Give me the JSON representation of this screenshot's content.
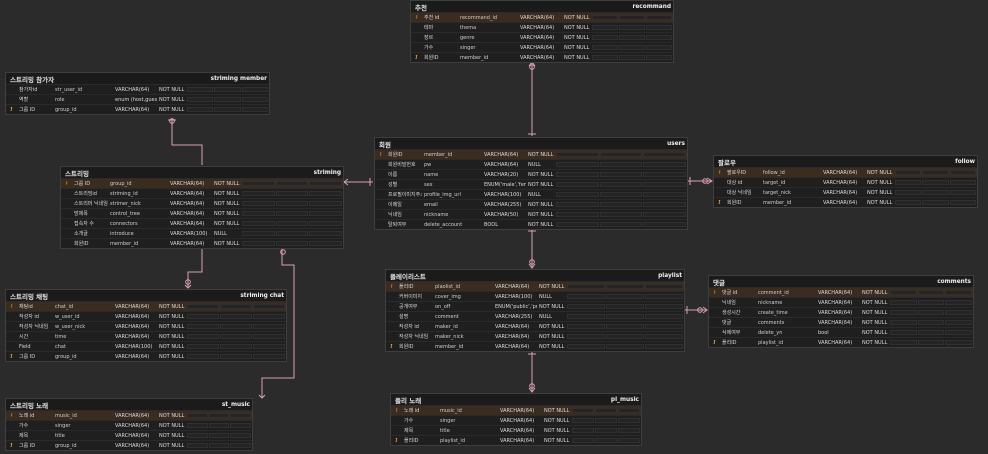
{
  "tables": [
    {
      "id": "recommand",
      "logical": "추천",
      "physical": "recommand",
      "rows": [
        {
          "key": "PK",
          "logical": "추천 id",
          "physical": "recommand_id",
          "type": "VARCHAR(64)",
          "nn": "NOT NULL"
        },
        {
          "key": "",
          "logical": "테마",
          "physical": "thema",
          "type": "VARCHAR(64)",
          "nn": "NOT NULL"
        },
        {
          "key": "",
          "logical": "장르",
          "physical": "genre",
          "type": "VARCHAR(64)",
          "nn": "NOT NULL"
        },
        {
          "key": "",
          "logical": "가수",
          "physical": "singer",
          "type": "VARCHAR(64)",
          "nn": "NOT NULL"
        },
        {
          "key": "FK",
          "logical": "회원ID",
          "physical": "member_id",
          "type": "VARCHAR(64)",
          "nn": "NOT NULL"
        }
      ]
    },
    {
      "id": "striming_member",
      "logical": "스트리밍 참가자",
      "physical": "striming member",
      "rows": [
        {
          "key": "",
          "logical": "참가자id",
          "physical": "str_user_id",
          "type": "VARCHAR(64)",
          "nn": "NOT NULL"
        },
        {
          "key": "",
          "logical": "역할",
          "physical": "role",
          "type": "enum (host,guest)",
          "nn": "NOT NULL"
        },
        {
          "key": "FK",
          "logical": "그룹 ID",
          "physical": "group_id",
          "type": "VARCHAR(64)",
          "nn": "NOT NULL"
        }
      ]
    },
    {
      "id": "users",
      "logical": "회원",
      "physical": "users",
      "rows": [
        {
          "key": "PK",
          "logical": "회원ID",
          "physical": "member_id",
          "type": "VARCHAR(64)",
          "nn": "NOT NULL"
        },
        {
          "key": "",
          "logical": "회원비밀번호",
          "physical": "pw",
          "type": "VARCHAR(64)",
          "nn": "NULL"
        },
        {
          "key": "",
          "logical": "이름",
          "physical": "name",
          "type": "VARCHAR(20)",
          "nn": "NOT NULL"
        },
        {
          "key": "",
          "logical": "성별",
          "physical": "sex",
          "type": "ENUM('male','female')",
          "nn": "NOT NULL"
        },
        {
          "key": "",
          "logical": "프로필이미지주소",
          "physical": "profile_img_url",
          "type": "VARCHAR(100)",
          "nn": "NULL"
        },
        {
          "key": "",
          "logical": "이메일",
          "physical": "email",
          "type": "VARCHAR(255)",
          "nn": "NOT NULL"
        },
        {
          "key": "",
          "logical": "닉네임",
          "physical": "nickname",
          "type": "VARCHAR(50)",
          "nn": "NOT NULL"
        },
        {
          "key": "",
          "logical": "탈퇴여부",
          "physical": "delete_account",
          "type": "BOOL",
          "nn": "NOT NULL"
        }
      ]
    },
    {
      "id": "striming",
      "logical": "스트리밍",
      "physical": "striming",
      "rows": [
        {
          "key": "PK",
          "logical": "그룹 ID",
          "physical": "group_id",
          "type": "VARCHAR(64)",
          "nn": "NOT NULL"
        },
        {
          "key": "",
          "logical": "스트리밍id",
          "physical": "striming_id",
          "type": "VARCHAR(64)",
          "nn": "NOT NULL"
        },
        {
          "key": "",
          "logical": "스트리머 닉네임",
          "physical": "strimer_nick",
          "type": "VARCHAR(64)",
          "nn": "NOT NULL"
        },
        {
          "key": "",
          "logical": "방제목",
          "physical": "control_tree",
          "type": "VARCHAR(64)",
          "nn": "NOT NULL"
        },
        {
          "key": "",
          "logical": "접속자 수",
          "physical": "connectors",
          "type": "VARCHAR(64)",
          "nn": "NOT NULL"
        },
        {
          "key": "",
          "logical": "소개글",
          "physical": "introduce",
          "type": "VARCHAR(100)",
          "nn": "NULL"
        },
        {
          "key": "",
          "logical": "회원ID",
          "physical": "member_id",
          "type": "VARCHAR(64)",
          "nn": "NOT NULL"
        }
      ]
    },
    {
      "id": "follow",
      "logical": "팔로우",
      "physical": "follow",
      "rows": [
        {
          "key": "PK",
          "logical": "팔로우ID",
          "physical": "follow_id",
          "type": "VARCHAR(64)",
          "nn": "NOT NULL"
        },
        {
          "key": "",
          "logical": "대상 id",
          "physical": "target_id",
          "type": "VARCHAR(64)",
          "nn": "NOT NULL"
        },
        {
          "key": "",
          "logical": "대상 닉네임",
          "physical": "target_nick",
          "type": "VARCHAR(64)",
          "nn": "NOT NULL"
        },
        {
          "key": "FK",
          "logical": "회원ID",
          "physical": "member_id",
          "type": "VARCHAR(64)",
          "nn": "NOT NULL"
        }
      ]
    },
    {
      "id": "playlist",
      "logical": "플레이리스트",
      "physical": "playlist",
      "rows": [
        {
          "key": "PK",
          "logical": "플리ID",
          "physical": "plaolist_id",
          "type": "VARCHAR(64)",
          "nn": "NOT NULL"
        },
        {
          "key": "",
          "logical": "커버이미지",
          "physical": "cover_img",
          "type": "VARCHAR(100)",
          "nn": "NULL"
        },
        {
          "key": "",
          "logical": "공개여부",
          "physical": "on_off",
          "type": "ENUM('public','private')",
          "nn": "NOT NULL"
        },
        {
          "key": "",
          "logical": "설명",
          "physical": "comment",
          "type": "VARCHAR(255)",
          "nn": "NULL"
        },
        {
          "key": "",
          "logical": "작성자 id",
          "physical": "maker_id",
          "type": "VARCHAR(64)",
          "nn": "NOT NULL"
        },
        {
          "key": "",
          "logical": "작성자 닉네임",
          "physical": "maker_nick",
          "type": "VARCHAR(64)",
          "nn": "NOT NULL"
        },
        {
          "key": "FK",
          "logical": "회원ID",
          "physical": "member_id",
          "type": "VARCHAR(64)",
          "nn": "NOT NULL"
        }
      ]
    },
    {
      "id": "comments",
      "logical": "댓글",
      "physical": "comments",
      "rows": [
        {
          "key": "PK",
          "logical": "댓글 id",
          "physical": "comment_id",
          "type": "VARCHAR(64)",
          "nn": "NOT NULL"
        },
        {
          "key": "",
          "logical": "닉네임",
          "physical": "nickname",
          "type": "VARCHAR(64)",
          "nn": "NOT NULL"
        },
        {
          "key": "",
          "logical": "생성시간",
          "physical": "create_time",
          "type": "VARCHAR(64)",
          "nn": "NOT NULL"
        },
        {
          "key": "",
          "logical": "댓글",
          "physical": "comments",
          "type": "VARCHAR(64)",
          "nn": "NOT NULL"
        },
        {
          "key": "",
          "logical": "삭제여부",
          "physical": "delete_yn",
          "type": "bool",
          "nn": "NOT NULL"
        },
        {
          "key": "FK",
          "logical": "플리ID",
          "physical": "playlist_id",
          "type": "VARCHAR(64)",
          "nn": "NOT NULL"
        }
      ]
    },
    {
      "id": "striming_chat",
      "logical": "스트리밍 채팅",
      "physical": "striming chat",
      "rows": [
        {
          "key": "PK",
          "logical": "채팅id",
          "physical": "chat_id",
          "type": "VARCHAR(64)",
          "nn": "NOT NULL"
        },
        {
          "key": "",
          "logical": "작성자 id",
          "physical": "w_user_id",
          "type": "VARCHAR(64)",
          "nn": "NOT NULL"
        },
        {
          "key": "",
          "logical": "작성자 닉네임",
          "physical": "w_user_nick",
          "type": "VARCHAR(64)",
          "nn": "NOT NULL"
        },
        {
          "key": "",
          "logical": "시간",
          "physical": "time",
          "type": "VARCHAR(64)",
          "nn": "NOT NULL"
        },
        {
          "key": "",
          "logical": "Field",
          "physical": "chat",
          "type": "VARCHAR(100)",
          "nn": "NOT NULL"
        },
        {
          "key": "FK",
          "logical": "그룹 ID",
          "physical": "group_id",
          "type": "VARCHAR(64)",
          "nn": "NOT NULL"
        }
      ]
    },
    {
      "id": "st_music",
      "logical": "스트리밍 노래",
      "physical": "st_music",
      "rows": [
        {
          "key": "PK",
          "logical": "노래 id",
          "physical": "music_id",
          "type": "VARCHAR(64)",
          "nn": "NOT NULL"
        },
        {
          "key": "",
          "logical": "가수",
          "physical": "singer",
          "type": "VARCHAR(64)",
          "nn": "NOT NULL"
        },
        {
          "key": "",
          "logical": "제목",
          "physical": "title",
          "type": "VARCHAR(64)",
          "nn": "NOT NULL"
        },
        {
          "key": "FK",
          "logical": "그룹 ID",
          "physical": "group_id",
          "type": "VARCHAR(64)",
          "nn": "NOT NULL"
        }
      ]
    },
    {
      "id": "pl_music",
      "logical": "플리 노래",
      "physical": "pl_music",
      "rows": [
        {
          "key": "PK",
          "logical": "노래 id",
          "physical": "music_id",
          "type": "VARCHAR(64)",
          "nn": "NOT NULL"
        },
        {
          "key": "",
          "logical": "가수",
          "physical": "singer",
          "type": "VARCHAR(64)",
          "nn": "NOT NULL"
        },
        {
          "key": "",
          "logical": "제목",
          "physical": "title",
          "type": "VARCHAR(64)",
          "nn": "NOT NULL"
        },
        {
          "key": "FK",
          "logical": "플리ID",
          "physical": "playlist_id",
          "type": "VARCHAR(64)",
          "nn": "NOT NULL"
        }
      ]
    }
  ],
  "colors": {
    "background": "#2b2b2b",
    "table": "#1b1b1b",
    "pk_row": "#3a2c1f",
    "key_text": "#e8a53a",
    "relation": "#d7a2b8"
  }
}
